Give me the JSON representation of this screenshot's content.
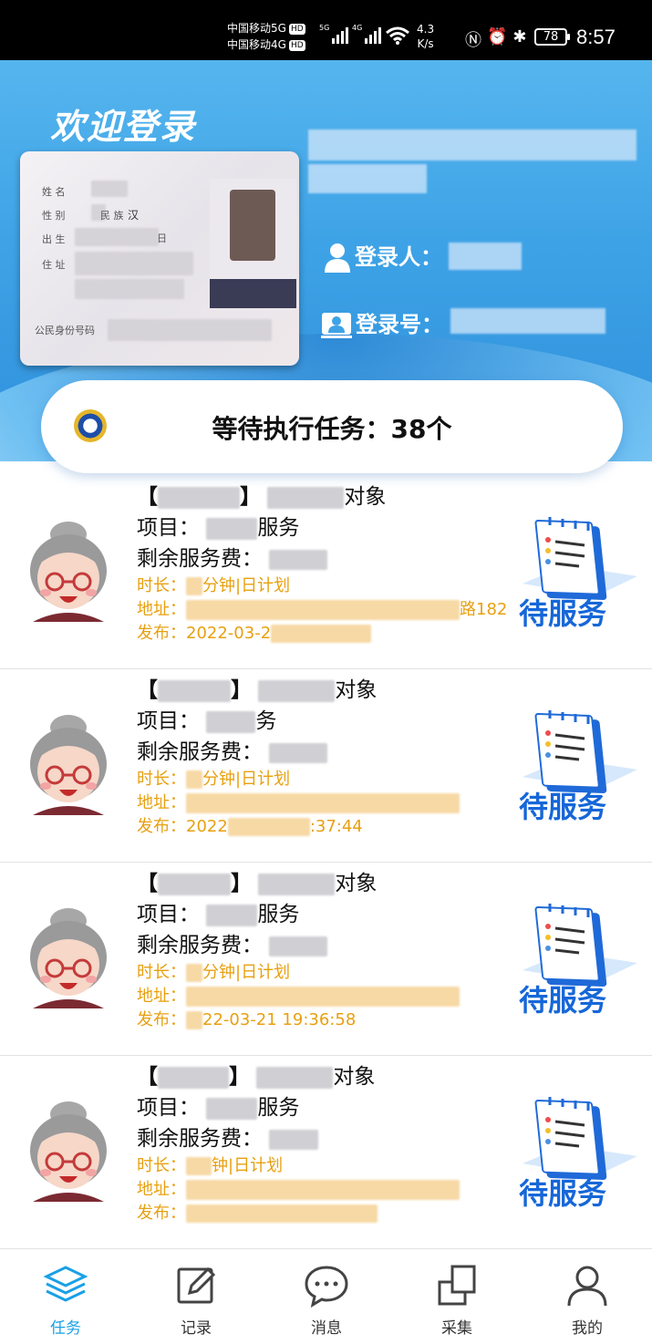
{
  "status_bar": {
    "carrier1": "中国移动5G",
    "carrier2": "中国移动4G",
    "hd": "HD",
    "sig1": "5G",
    "sig2": "4G",
    "speed_value": "4.3",
    "speed_unit": "K/s",
    "battery": "78",
    "time": "8:57"
  },
  "header": {
    "welcome": "欢迎登录",
    "id_card": {
      "name_label": "姓 名",
      "gender_label": "性 别",
      "ethnicity_label": "民 族",
      "ethnicity_value": "汉",
      "birth_label": "出 生",
      "birth_tail": "日",
      "address_label": "住 址",
      "id_label": "公民身份号码"
    },
    "login_person_label": "登录人：",
    "login_number_label": "登录号："
  },
  "pending": {
    "text": "等待执行任务：38个"
  },
  "tasks": [
    {
      "bracket_open": "【",
      "bracket_close": "】",
      "object_suffix": "对象",
      "project_label": "项目：",
      "project_suffix": "服务",
      "fee_label": "剩余服务费：",
      "duration_label": "时长：",
      "duration_value": "分钟|日计划",
      "address_label": "地址：",
      "address_tail": "路182",
      "publish_label": "发布：",
      "publish_value": "2022-03-2",
      "status": "待服务"
    },
    {
      "bracket_open": "【",
      "bracket_close": "】",
      "object_suffix": "对象",
      "project_label": "项目：",
      "project_suffix": "务",
      "fee_label": "剩余服务费：",
      "duration_label": "时长：",
      "duration_value": "分钟|日计划",
      "address_label": "地址：",
      "address_tail": "",
      "publish_label": "发布：",
      "publish_value": "2022",
      "publish_tail": ":37:44",
      "status": "待服务"
    },
    {
      "bracket_open": "【",
      "bracket_close": "】",
      "object_suffix": "对象",
      "project_label": "项目：",
      "project_suffix": "服务",
      "fee_label": "剩余服务费：",
      "duration_label": "时长：",
      "duration_value": "分钟|日计划",
      "address_label": "地址：",
      "address_tail": "",
      "publish_label": "发布：",
      "publish_value": "",
      "publish_tail": "22-03-21 19:36:58",
      "status": "待服务"
    },
    {
      "bracket_open": "【",
      "bracket_close": "】",
      "object_suffix": "对象",
      "project_label": "项目：",
      "project_suffix": "服务",
      "fee_label": "剩余服务费：",
      "duration_label": "时长：",
      "duration_value": "钟|日计划",
      "address_label": "地址：",
      "address_tail": "",
      "publish_label": "发布：",
      "publish_value": "",
      "status": "待服务"
    }
  ],
  "tabs": [
    {
      "label": "任务",
      "icon": "layers-icon",
      "active": true
    },
    {
      "label": "记录",
      "icon": "edit-icon"
    },
    {
      "label": "消息",
      "icon": "chat-icon"
    },
    {
      "label": "采集",
      "icon": "collect-icon"
    },
    {
      "label": "我的",
      "icon": "user-icon"
    }
  ],
  "colors": {
    "header_blue": "#3ea3e6",
    "accent_orange": "#e8a010",
    "status_blue": "#1667d8",
    "tab_active": "#1aa0e6"
  }
}
